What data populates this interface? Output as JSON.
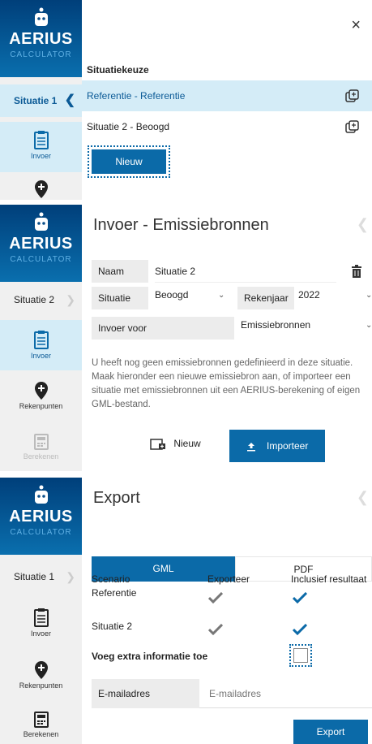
{
  "app": {
    "logo_word": "AERIUS",
    "logo_sub": "CALCULATOR"
  },
  "colors": {
    "brand": "#0b6aa8",
    "selected": "#d4ecf7",
    "sidebar": "#f0f0f0"
  },
  "nav": {
    "invoer": "Invoer",
    "rekenpunten": "Rekenpunten",
    "berekenen": "Berekenen"
  },
  "panel1": {
    "situation_tab": "Situatie 1",
    "section_label": "Situatiekeuze",
    "rows": [
      "Referentie - Referentie",
      "Situatie 2 - Beoogd"
    ],
    "new_button": "Nieuw",
    "close_icon": "×"
  },
  "panel2": {
    "situation_tab": "Situatie 2",
    "title": "Invoer - Emissiebronnen",
    "name_label": "Naam",
    "name_value": "Situatie 2",
    "situation_label": "Situatie",
    "situation_value": "Beoogd",
    "year_label": "Rekenjaar",
    "year_value": "2022",
    "input_for_label": "Invoer voor",
    "input_for_value": "Emissiebronnen",
    "info": "U heeft nog geen emissiebronnen gedefinieerd in deze situatie. Maak hieronder een nieuwe emissiebron aan, of importeer een situatie met emissiebronnen uit een AERIUS-berekening of eigen GML-bestand.",
    "new_button": "Nieuw",
    "import_button": "Importeer"
  },
  "panel3": {
    "situation_tab": "Situatie 1",
    "title": "Export",
    "tabs": [
      "GML",
      "PDF"
    ],
    "col_scenario": "Scenario",
    "col_export": "Exporteer",
    "col_results": "Inclusief resultaat",
    "rows": [
      "Referentie",
      "Situatie 2"
    ],
    "extra_info": "Voeg extra informatie toe",
    "email_label": "E-mailadres",
    "email_placeholder": "E-mailadres",
    "export_button": "Export"
  }
}
